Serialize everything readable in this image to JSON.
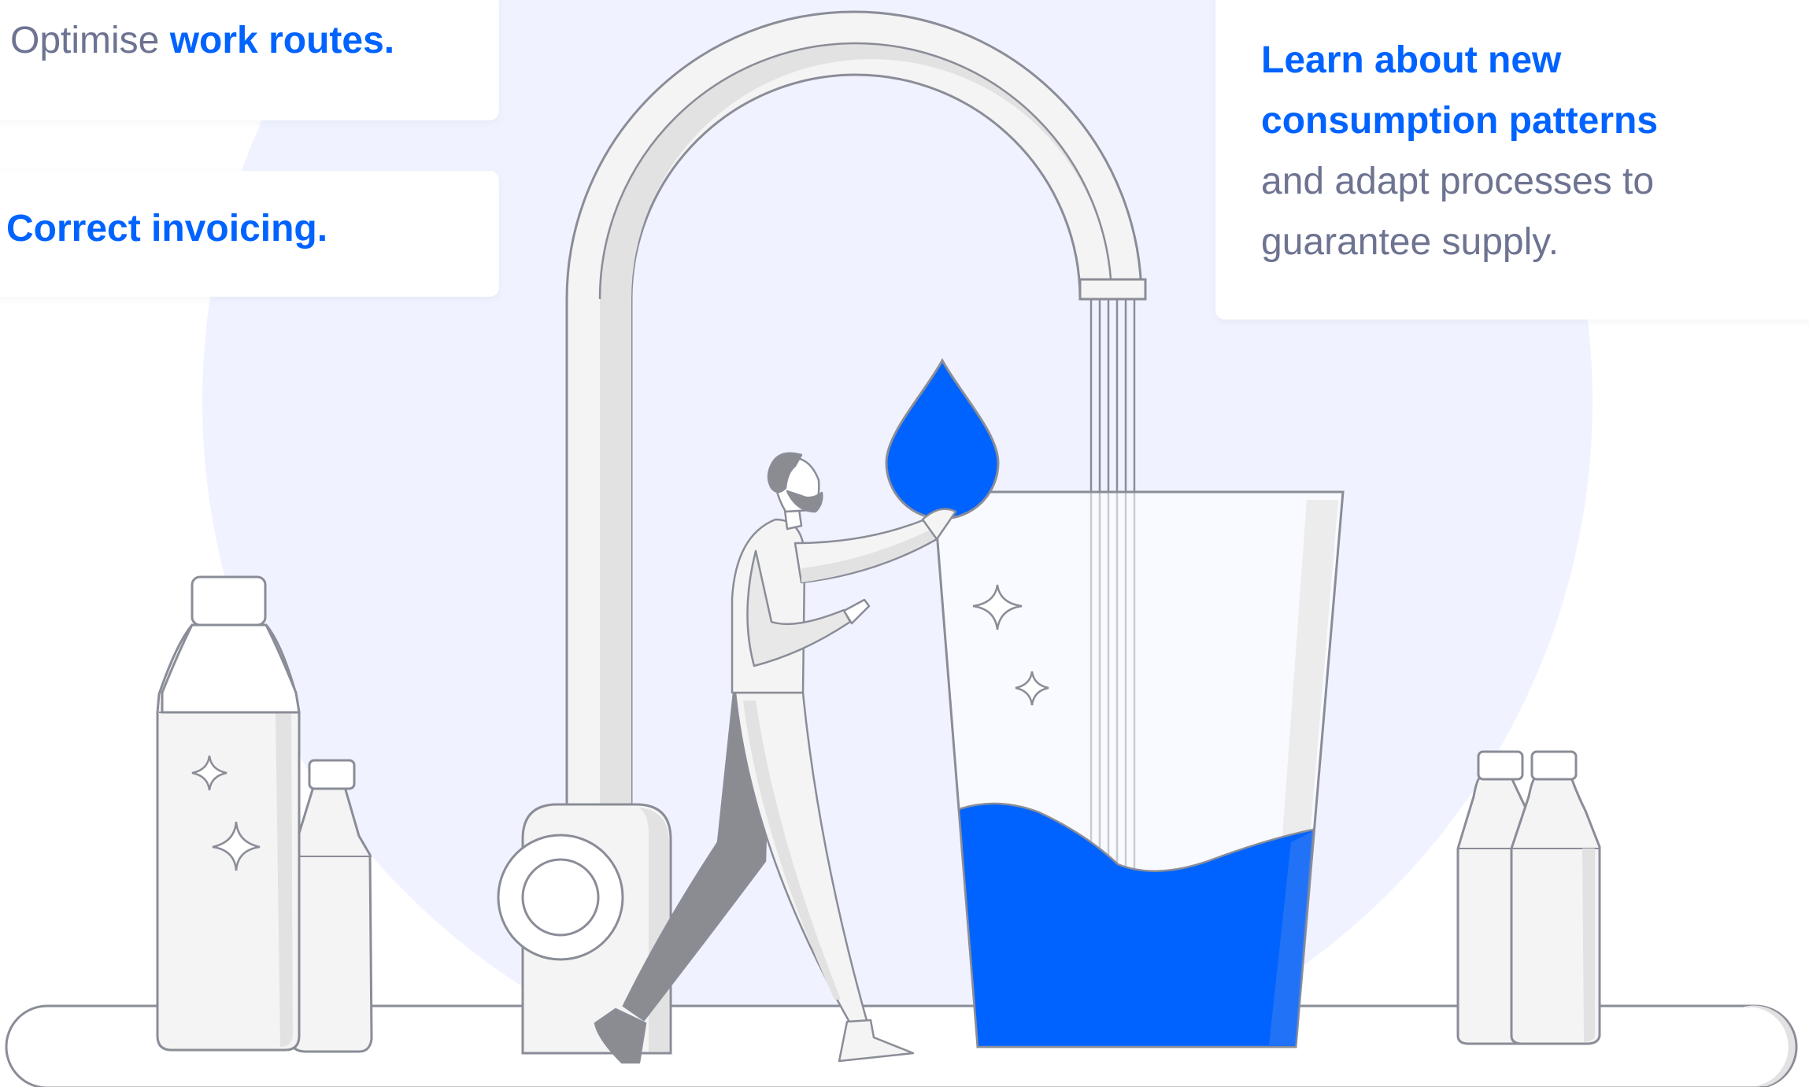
{
  "colors": {
    "accent": "#0063ff",
    "muted_text": "#6d7391",
    "background_circle": "#f0f3ff",
    "outline": "#8a8d97",
    "fill_light": "#f4f4f4",
    "fill_shade": "#e2e2e2",
    "fill_dark": "#8a8c91"
  },
  "cards": {
    "routes": {
      "prefix": "Optimise ",
      "highlight": "work routes."
    },
    "invoicing": {
      "highlight": "Correct invoicing."
    },
    "consumption": {
      "highlight_line1": "Learn about new",
      "highlight_line2": "consumption patterns",
      "body_line1": "and adapt processes to",
      "body_line2": "guarantee supply."
    }
  },
  "illustration": {
    "icons": [
      "water-tap-icon",
      "water-drop-icon",
      "water-glass-icon",
      "person-icon",
      "water-bottle-icon",
      "sparkle-icon"
    ]
  }
}
